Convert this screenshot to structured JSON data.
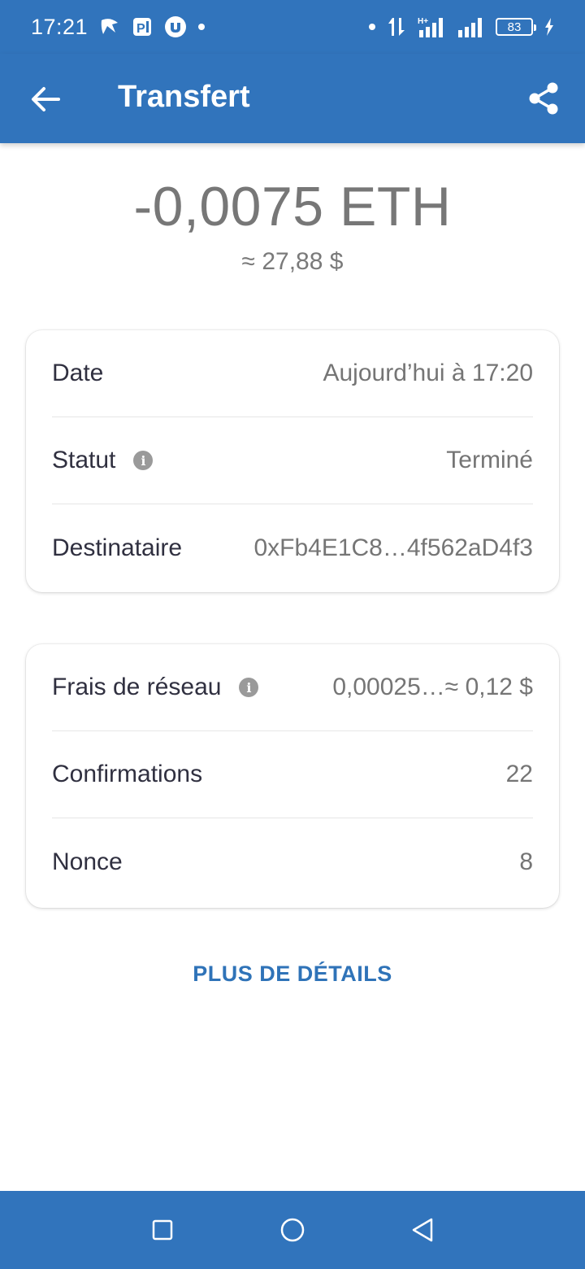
{
  "status_bar": {
    "time": "17:21",
    "battery_level": "83",
    "icons": [
      "notification-app-icon",
      "parking-app-icon",
      "torrent-app-icon",
      "dot-icon",
      "dot-icon",
      "data-transfer-icon",
      "signal-h-plus-icon",
      "signal-icon",
      "battery-icon",
      "charging-icon"
    ]
  },
  "app_bar": {
    "title": "Transfert",
    "back_icon": "arrow-left-icon",
    "share_icon": "share-icon"
  },
  "transaction": {
    "amount": "-0,0075 ETH",
    "fiat": "≈ 27,88 $"
  },
  "card1": {
    "rows": [
      {
        "label": "Date",
        "value": "Aujourd’hui à 17:20"
      },
      {
        "label": "Statut",
        "value": "Terminé",
        "info": true
      },
      {
        "label": "Destinataire",
        "value": "0xFb4E1C8…4f562aD4f3"
      }
    ]
  },
  "card2": {
    "rows": [
      {
        "label": "Frais de réseau",
        "value": "0,00025…≈ 0,12 $",
        "info": true
      },
      {
        "label": "Confirmations",
        "value": "22"
      },
      {
        "label": "Nonce",
        "value": "8"
      }
    ]
  },
  "info_icon_glyph": "i",
  "more_details_label": "PLUS DE DÉTAILS",
  "nav_bar": {
    "icons": [
      "square-recents-icon",
      "circle-home-icon",
      "triangle-back-icon"
    ]
  },
  "colors": {
    "primary": "#3174bc",
    "link": "#2f73b8",
    "text_dark": "#303040",
    "text_muted": "#757575"
  }
}
